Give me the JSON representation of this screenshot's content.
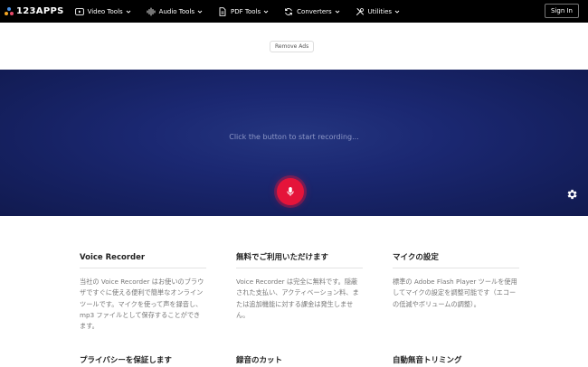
{
  "brand": {
    "name": "123APPS"
  },
  "nav": {
    "items": [
      {
        "label": "Video Tools",
        "icon": "video-icon"
      },
      {
        "label": "Audio Tools",
        "icon": "waveform-icon"
      },
      {
        "label": "PDF Tools",
        "icon": "document-icon"
      },
      {
        "label": "Converters",
        "icon": "convert-icon"
      },
      {
        "label": "Utilities",
        "icon": "utilities-icon"
      }
    ],
    "signin": "Sign In"
  },
  "ad": {
    "remove_label": "Remove Ads"
  },
  "hero": {
    "hint": "Click the button to start recording..."
  },
  "features": [
    {
      "title": "Voice Recorder",
      "text": "当社の Voice Recorder はお使いのブラウザですぐに使える便利で簡単なオンラインツールです。マイクを使って声を録音し、mp3 ファイルとして保存することができます。"
    },
    {
      "title": "無料でご利用いただけます",
      "text": "Voice Recorder は完全に無料です。隠蔽された支払い、アクティベーション料、または追加機能に対する課金は発生しません。"
    },
    {
      "title": "マイクの設定",
      "text": "標準の Adobe Flash Player ツールを使用してマイクの設定を調整可能です（エコーの低減やボリュームの調整）。"
    }
  ],
  "features_row2": [
    {
      "title": "プライバシーを保証します"
    },
    {
      "title": "録音のカット"
    },
    {
      "title": "自動無音トリミング"
    }
  ],
  "colors": {
    "accent": "#e5143a",
    "hero": "#1b2872",
    "topbar": "#000000"
  }
}
